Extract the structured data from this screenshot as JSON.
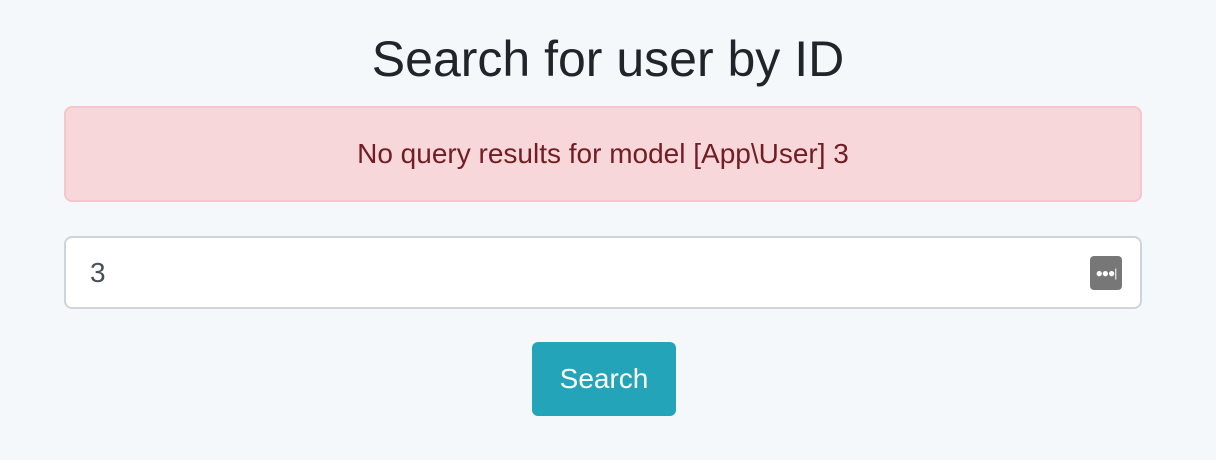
{
  "title": "Search for user by ID",
  "alert": "No query results for model [App\\User] 3",
  "input": {
    "value": "3"
  },
  "button": "Search"
}
